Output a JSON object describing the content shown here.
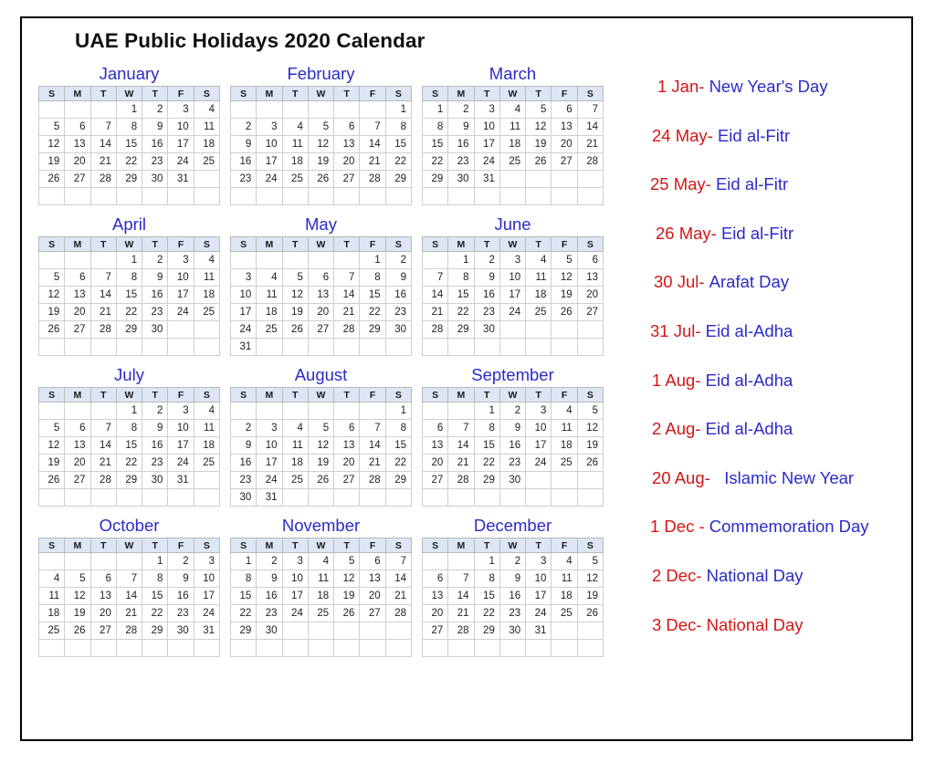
{
  "title": "UAE Public Holidays 2020 Calendar",
  "weekday_headers": [
    "S",
    "M",
    "T",
    "W",
    "T",
    "F",
    "S"
  ],
  "months": [
    {
      "name": "January",
      "weeks": [
        [
          "",
          "",
          "",
          "1",
          "2",
          "3",
          "4"
        ],
        [
          "5",
          "6",
          "7",
          "8",
          "9",
          "10",
          "11"
        ],
        [
          "12",
          "13",
          "14",
          "15",
          "16",
          "17",
          "18"
        ],
        [
          "19",
          "20",
          "21",
          "22",
          "23",
          "24",
          "25"
        ],
        [
          "26",
          "27",
          "28",
          "29",
          "30",
          "31",
          ""
        ],
        [
          "",
          "",
          "",
          "",
          "",
          "",
          ""
        ]
      ]
    },
    {
      "name": "February",
      "weeks": [
        [
          "",
          "",
          "",
          "",
          "",
          "",
          "1"
        ],
        [
          "2",
          "3",
          "4",
          "5",
          "6",
          "7",
          "8"
        ],
        [
          "9",
          "10",
          "11",
          "12",
          "13",
          "14",
          "15"
        ],
        [
          "16",
          "17",
          "18",
          "19",
          "20",
          "21",
          "22"
        ],
        [
          "23",
          "24",
          "25",
          "26",
          "27",
          "28",
          "29"
        ],
        [
          "",
          "",
          "",
          "",
          "",
          "",
          ""
        ]
      ]
    },
    {
      "name": "March",
      "weeks": [
        [
          "1",
          "2",
          "3",
          "4",
          "5",
          "6",
          "7"
        ],
        [
          "8",
          "9",
          "10",
          "11",
          "12",
          "13",
          "14"
        ],
        [
          "15",
          "16",
          "17",
          "18",
          "19",
          "20",
          "21"
        ],
        [
          "22",
          "23",
          "24",
          "25",
          "26",
          "27",
          "28"
        ],
        [
          "29",
          "30",
          "31",
          "",
          "",
          "",
          ""
        ],
        [
          "",
          "",
          "",
          "",
          "",
          "",
          ""
        ]
      ]
    },
    {
      "name": "April",
      "weeks": [
        [
          "",
          "",
          "",
          "1",
          "2",
          "3",
          "4"
        ],
        [
          "5",
          "6",
          "7",
          "8",
          "9",
          "10",
          "11"
        ],
        [
          "12",
          "13",
          "14",
          "15",
          "16",
          "17",
          "18"
        ],
        [
          "19",
          "20",
          "21",
          "22",
          "23",
          "24",
          "25"
        ],
        [
          "26",
          "27",
          "28",
          "29",
          "30",
          "",
          ""
        ],
        [
          "",
          "",
          "",
          "",
          "",
          "",
          ""
        ]
      ]
    },
    {
      "name": "May",
      "weeks": [
        [
          "",
          "",
          "",
          "",
          "",
          "1",
          "2"
        ],
        [
          "3",
          "4",
          "5",
          "6",
          "7",
          "8",
          "9"
        ],
        [
          "10",
          "11",
          "12",
          "13",
          "14",
          "15",
          "16"
        ],
        [
          "17",
          "18",
          "19",
          "20",
          "21",
          "22",
          "23"
        ],
        [
          "24",
          "25",
          "26",
          "27",
          "28",
          "29",
          "30"
        ],
        [
          "31",
          "",
          "",
          "",
          "",
          "",
          ""
        ]
      ]
    },
    {
      "name": "June",
      "weeks": [
        [
          "",
          "1",
          "2",
          "3",
          "4",
          "5",
          "6"
        ],
        [
          "7",
          "8",
          "9",
          "10",
          "11",
          "12",
          "13"
        ],
        [
          "14",
          "15",
          "16",
          "17",
          "18",
          "19",
          "20"
        ],
        [
          "21",
          "22",
          "23",
          "24",
          "25",
          "26",
          "27"
        ],
        [
          "28",
          "29",
          "30",
          "",
          "",
          "",
          ""
        ],
        [
          "",
          "",
          "",
          "",
          "",
          "",
          ""
        ]
      ]
    },
    {
      "name": "July",
      "weeks": [
        [
          "",
          "",
          "",
          "1",
          "2",
          "3",
          "4"
        ],
        [
          "5",
          "6",
          "7",
          "8",
          "9",
          "10",
          "11"
        ],
        [
          "12",
          "13",
          "14",
          "15",
          "16",
          "17",
          "18"
        ],
        [
          "19",
          "20",
          "21",
          "22",
          "23",
          "24",
          "25"
        ],
        [
          "26",
          "27",
          "28",
          "29",
          "30",
          "31",
          ""
        ],
        [
          "",
          "",
          "",
          "",
          "",
          "",
          ""
        ]
      ]
    },
    {
      "name": "August",
      "weeks": [
        [
          "",
          "",
          "",
          "",
          "",
          "",
          "1"
        ],
        [
          "2",
          "3",
          "4",
          "5",
          "6",
          "7",
          "8"
        ],
        [
          "9",
          "10",
          "11",
          "12",
          "13",
          "14",
          "15"
        ],
        [
          "16",
          "17",
          "18",
          "19",
          "20",
          "21",
          "22"
        ],
        [
          "23",
          "24",
          "25",
          "26",
          "27",
          "28",
          "29"
        ],
        [
          "30",
          "31",
          "",
          "",
          "",
          "",
          ""
        ]
      ]
    },
    {
      "name": "September",
      "weeks": [
        [
          "",
          "",
          "1",
          "2",
          "3",
          "4",
          "5"
        ],
        [
          "6",
          "7",
          "8",
          "9",
          "10",
          "11",
          "12"
        ],
        [
          "13",
          "14",
          "15",
          "16",
          "17",
          "18",
          "19"
        ],
        [
          "20",
          "21",
          "22",
          "23",
          "24",
          "25",
          "26"
        ],
        [
          "27",
          "28",
          "29",
          "30",
          "",
          "",
          ""
        ],
        [
          "",
          "",
          "",
          "",
          "",
          "",
          ""
        ]
      ]
    },
    {
      "name": "October",
      "weeks": [
        [
          "",
          "",
          "",
          "",
          "1",
          "2",
          "3"
        ],
        [
          "4",
          "5",
          "6",
          "7",
          "8",
          "9",
          "10"
        ],
        [
          "11",
          "12",
          "13",
          "14",
          "15",
          "16",
          "17"
        ],
        [
          "18",
          "19",
          "20",
          "21",
          "22",
          "23",
          "24"
        ],
        [
          "25",
          "26",
          "27",
          "28",
          "29",
          "30",
          "31"
        ],
        [
          "",
          "",
          "",
          "",
          "",
          "",
          ""
        ]
      ]
    },
    {
      "name": "November",
      "weeks": [
        [
          "1",
          "2",
          "3",
          "4",
          "5",
          "6",
          "7"
        ],
        [
          "8",
          "9",
          "10",
          "11",
          "12",
          "13",
          "14"
        ],
        [
          "15",
          "16",
          "17",
          "18",
          "19",
          "20",
          "21"
        ],
        [
          "22",
          "23",
          "24",
          "25",
          "26",
          "27",
          "28"
        ],
        [
          "29",
          "30",
          "",
          "",
          "",
          "",
          ""
        ],
        [
          "",
          "",
          "",
          "",
          "",
          "",
          ""
        ]
      ]
    },
    {
      "name": "December",
      "weeks": [
        [
          "",
          "",
          "1",
          "2",
          "3",
          "4",
          "5"
        ],
        [
          "6",
          "7",
          "8",
          "9",
          "10",
          "11",
          "12"
        ],
        [
          "13",
          "14",
          "15",
          "16",
          "17",
          "18",
          "19"
        ],
        [
          "20",
          "21",
          "22",
          "23",
          "24",
          "25",
          "26"
        ],
        [
          "27",
          "28",
          "29",
          "30",
          "31",
          "",
          ""
        ],
        [
          "",
          "",
          "",
          "",
          "",
          "",
          ""
        ]
      ]
    }
  ],
  "holidays": [
    {
      "date": "1 Jan-",
      "name": "New Year's Day"
    },
    {
      "date": "24 May-",
      "name": "Eid al-Fitr"
    },
    {
      "date": "25 May-",
      "name": "Eid al-Fitr"
    },
    {
      "date": "26 May-",
      "name": "Eid al-Fitr"
    },
    {
      "date": "30 Jul-",
      "name": "Arafat Day"
    },
    {
      "date": "31 Jul-",
      "name": "Eid al-Adha"
    },
    {
      "date": "1 Aug-",
      "name": "Eid al-Adha"
    },
    {
      "date": "2 Aug-",
      "name": "Eid al-Adha"
    },
    {
      "date": "20 Aug-",
      "name": "Islamic New Year"
    },
    {
      "date": "1 Dec -",
      "name": "Commemoration Day"
    },
    {
      "date": "2 Dec-",
      "name": "National Day"
    },
    {
      "date": "3 Dec-",
      "name": "National Day"
    }
  ],
  "colors": {
    "month_name": "#2b2bc8",
    "holiday_date": "#d41616",
    "holiday_name": "#2b2bc8",
    "header_bg": "#dce6f5",
    "border": "#000000"
  }
}
